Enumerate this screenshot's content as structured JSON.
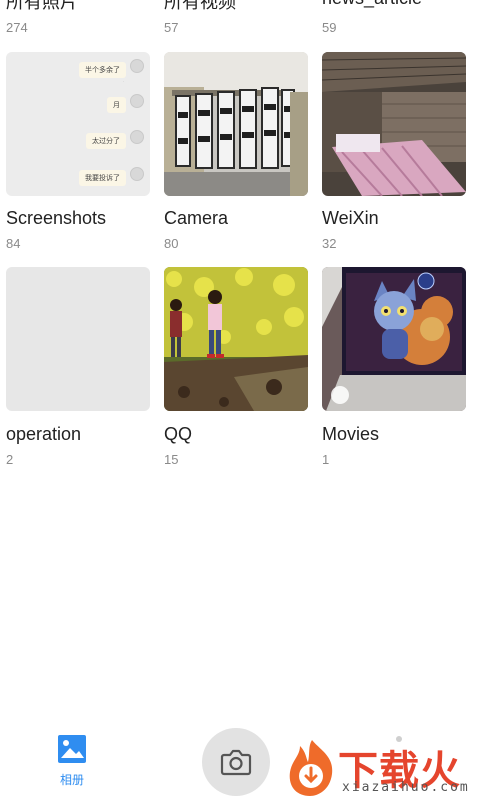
{
  "albums_row0": [
    {
      "name": "所有照片",
      "count": "274"
    },
    {
      "name": "所有视频",
      "count": "57"
    },
    {
      "name": "news_article",
      "count": "59"
    }
  ],
  "albums": [
    {
      "name": "Screenshots",
      "count": "84"
    },
    {
      "name": "Camera",
      "count": "80"
    },
    {
      "name": "WeiXin",
      "count": "32"
    },
    {
      "name": "operation",
      "count": "2"
    },
    {
      "name": "QQ",
      "count": "15"
    },
    {
      "name": "Movies",
      "count": "1"
    }
  ],
  "screenshot_thumb": {
    "bubbles": [
      "半个多余了",
      "月",
      "太过分了",
      "我要投诉了"
    ]
  },
  "bottom_bar": {
    "albums_tab_label": "相册",
    "camera_icon": "camera-icon",
    "albums_icon": "image-icon"
  },
  "watermark": {
    "brand": "下载火",
    "domain": "xiazaihuo.com"
  },
  "colors": {
    "accent": "#2f8df0",
    "watermark": "#e5452d"
  }
}
